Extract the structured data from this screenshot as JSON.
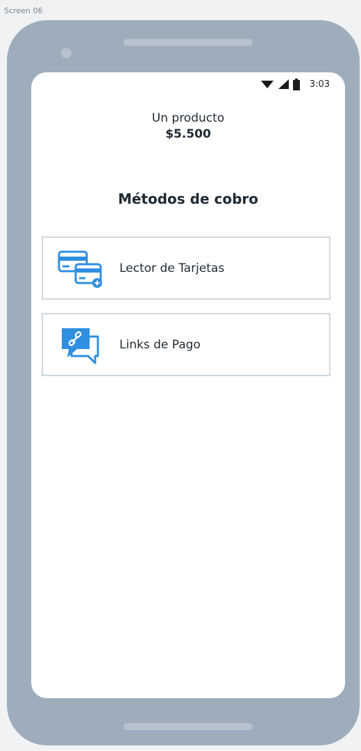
{
  "frame": {
    "label": "Screen 06"
  },
  "status_bar": {
    "time": "3:03",
    "icons": [
      "wifi-icon",
      "cellular-signal-icon",
      "battery-icon"
    ]
  },
  "product": {
    "name": "Un producto",
    "price": "$5.500"
  },
  "payment_methods": {
    "title": "Métodos de cobro",
    "items": [
      {
        "label": "Lector de Tarjetas",
        "icon": "card-reader-icon"
      },
      {
        "label": "Links de Pago",
        "icon": "payment-link-chat-icon"
      }
    ]
  },
  "colors": {
    "phone_body": "#9dadbc",
    "accent_blue": "#2f8fe0",
    "card_border": "#cfd8df",
    "text_dark": "#1f2a33"
  }
}
